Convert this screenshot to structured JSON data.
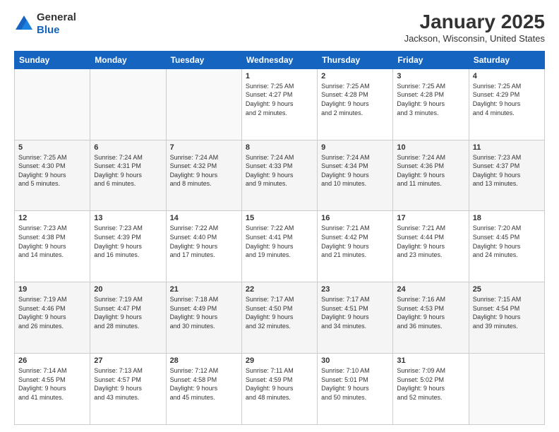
{
  "header": {
    "logo_line1": "General",
    "logo_line2": "Blue",
    "month": "January 2025",
    "location": "Jackson, Wisconsin, United States"
  },
  "days_of_week": [
    "Sunday",
    "Monday",
    "Tuesday",
    "Wednesday",
    "Thursday",
    "Friday",
    "Saturday"
  ],
  "weeks": [
    [
      {
        "day": "",
        "info": ""
      },
      {
        "day": "",
        "info": ""
      },
      {
        "day": "",
        "info": ""
      },
      {
        "day": "1",
        "info": "Sunrise: 7:25 AM\nSunset: 4:27 PM\nDaylight: 9 hours\nand 2 minutes."
      },
      {
        "day": "2",
        "info": "Sunrise: 7:25 AM\nSunset: 4:28 PM\nDaylight: 9 hours\nand 2 minutes."
      },
      {
        "day": "3",
        "info": "Sunrise: 7:25 AM\nSunset: 4:28 PM\nDaylight: 9 hours\nand 3 minutes."
      },
      {
        "day": "4",
        "info": "Sunrise: 7:25 AM\nSunset: 4:29 PM\nDaylight: 9 hours\nand 4 minutes."
      }
    ],
    [
      {
        "day": "5",
        "info": "Sunrise: 7:25 AM\nSunset: 4:30 PM\nDaylight: 9 hours\nand 5 minutes."
      },
      {
        "day": "6",
        "info": "Sunrise: 7:24 AM\nSunset: 4:31 PM\nDaylight: 9 hours\nand 6 minutes."
      },
      {
        "day": "7",
        "info": "Sunrise: 7:24 AM\nSunset: 4:32 PM\nDaylight: 9 hours\nand 8 minutes."
      },
      {
        "day": "8",
        "info": "Sunrise: 7:24 AM\nSunset: 4:33 PM\nDaylight: 9 hours\nand 9 minutes."
      },
      {
        "day": "9",
        "info": "Sunrise: 7:24 AM\nSunset: 4:34 PM\nDaylight: 9 hours\nand 10 minutes."
      },
      {
        "day": "10",
        "info": "Sunrise: 7:24 AM\nSunset: 4:36 PM\nDaylight: 9 hours\nand 11 minutes."
      },
      {
        "day": "11",
        "info": "Sunrise: 7:23 AM\nSunset: 4:37 PM\nDaylight: 9 hours\nand 13 minutes."
      }
    ],
    [
      {
        "day": "12",
        "info": "Sunrise: 7:23 AM\nSunset: 4:38 PM\nDaylight: 9 hours\nand 14 minutes."
      },
      {
        "day": "13",
        "info": "Sunrise: 7:23 AM\nSunset: 4:39 PM\nDaylight: 9 hours\nand 16 minutes."
      },
      {
        "day": "14",
        "info": "Sunrise: 7:22 AM\nSunset: 4:40 PM\nDaylight: 9 hours\nand 17 minutes."
      },
      {
        "day": "15",
        "info": "Sunrise: 7:22 AM\nSunset: 4:41 PM\nDaylight: 9 hours\nand 19 minutes."
      },
      {
        "day": "16",
        "info": "Sunrise: 7:21 AM\nSunset: 4:42 PM\nDaylight: 9 hours\nand 21 minutes."
      },
      {
        "day": "17",
        "info": "Sunrise: 7:21 AM\nSunset: 4:44 PM\nDaylight: 9 hours\nand 23 minutes."
      },
      {
        "day": "18",
        "info": "Sunrise: 7:20 AM\nSunset: 4:45 PM\nDaylight: 9 hours\nand 24 minutes."
      }
    ],
    [
      {
        "day": "19",
        "info": "Sunrise: 7:19 AM\nSunset: 4:46 PM\nDaylight: 9 hours\nand 26 minutes."
      },
      {
        "day": "20",
        "info": "Sunrise: 7:19 AM\nSunset: 4:47 PM\nDaylight: 9 hours\nand 28 minutes."
      },
      {
        "day": "21",
        "info": "Sunrise: 7:18 AM\nSunset: 4:49 PM\nDaylight: 9 hours\nand 30 minutes."
      },
      {
        "day": "22",
        "info": "Sunrise: 7:17 AM\nSunset: 4:50 PM\nDaylight: 9 hours\nand 32 minutes."
      },
      {
        "day": "23",
        "info": "Sunrise: 7:17 AM\nSunset: 4:51 PM\nDaylight: 9 hours\nand 34 minutes."
      },
      {
        "day": "24",
        "info": "Sunrise: 7:16 AM\nSunset: 4:53 PM\nDaylight: 9 hours\nand 36 minutes."
      },
      {
        "day": "25",
        "info": "Sunrise: 7:15 AM\nSunset: 4:54 PM\nDaylight: 9 hours\nand 39 minutes."
      }
    ],
    [
      {
        "day": "26",
        "info": "Sunrise: 7:14 AM\nSunset: 4:55 PM\nDaylight: 9 hours\nand 41 minutes."
      },
      {
        "day": "27",
        "info": "Sunrise: 7:13 AM\nSunset: 4:57 PM\nDaylight: 9 hours\nand 43 minutes."
      },
      {
        "day": "28",
        "info": "Sunrise: 7:12 AM\nSunset: 4:58 PM\nDaylight: 9 hours\nand 45 minutes."
      },
      {
        "day": "29",
        "info": "Sunrise: 7:11 AM\nSunset: 4:59 PM\nDaylight: 9 hours\nand 48 minutes."
      },
      {
        "day": "30",
        "info": "Sunrise: 7:10 AM\nSunset: 5:01 PM\nDaylight: 9 hours\nand 50 minutes."
      },
      {
        "day": "31",
        "info": "Sunrise: 7:09 AM\nSunset: 5:02 PM\nDaylight: 9 hours\nand 52 minutes."
      },
      {
        "day": "",
        "info": ""
      }
    ]
  ]
}
